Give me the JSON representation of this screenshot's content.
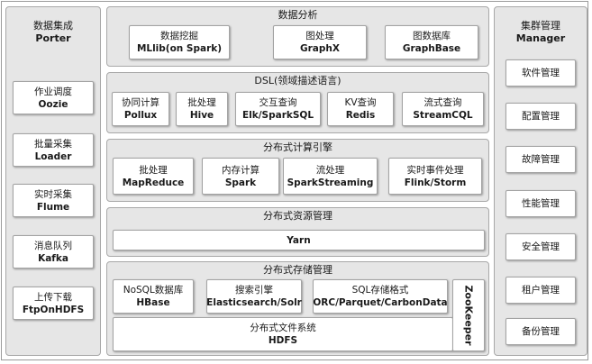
{
  "left": {
    "title_cn": "数据集成",
    "title_en": "Porter",
    "items": [
      {
        "cn": "作业调度",
        "en": "Oozie"
      },
      {
        "cn": "批量采集",
        "en": "Loader"
      },
      {
        "cn": "实时采集",
        "en": "Flume"
      },
      {
        "cn": "消息队列",
        "en": "Kafka"
      },
      {
        "cn": "上传下载",
        "en": "FtpOnHDFS"
      }
    ]
  },
  "analysis": {
    "title": "数据分析",
    "items": [
      {
        "cn": "数据挖掘",
        "en": "MLlib(on Spark)"
      },
      {
        "cn": "图处理",
        "en": "GraphX"
      },
      {
        "cn": "图数据库",
        "en": "GraphBase"
      }
    ]
  },
  "dsl": {
    "title": "DSL(领域描述语言)",
    "items": [
      {
        "cn": "协同计算",
        "en": "Pollux"
      },
      {
        "cn": "批处理",
        "en": "Hive"
      },
      {
        "cn": "交互查询",
        "en": "Elk/SparkSQL"
      },
      {
        "cn": "KV查询",
        "en": "Redis"
      },
      {
        "cn": "流式查询",
        "en": "StreamCQL"
      }
    ]
  },
  "compute": {
    "title": "分布式计算引擎",
    "items": [
      {
        "cn": "批处理",
        "en": "MapReduce"
      },
      {
        "cn": "内存计算",
        "en": "Spark"
      },
      {
        "cn": "流处理",
        "en": "SparkStreaming"
      },
      {
        "cn": "实时事件处理",
        "en": "Flink/Storm"
      }
    ]
  },
  "resource": {
    "title": "分布式资源管理",
    "items": [
      {
        "en": "Yarn"
      }
    ]
  },
  "storage": {
    "title": "分布式存储管理",
    "items": [
      {
        "cn": "NoSQL数据库",
        "en": "HBase"
      },
      {
        "cn": "搜索引擎",
        "en": "Elasticsearch/Solr"
      },
      {
        "cn": "SQL存储格式",
        "en": "ORC/Parquet/CarbonData"
      }
    ],
    "fs": {
      "cn": "分布式文件系统",
      "en": "HDFS"
    },
    "zookeeper": "ZooKeeper"
  },
  "right": {
    "title_cn": "集群管理",
    "title_en": "Manager",
    "items": [
      "软件管理",
      "配置管理",
      "故障管理",
      "性能管理",
      "安全管理",
      "租户管理",
      "备份管理"
    ]
  }
}
